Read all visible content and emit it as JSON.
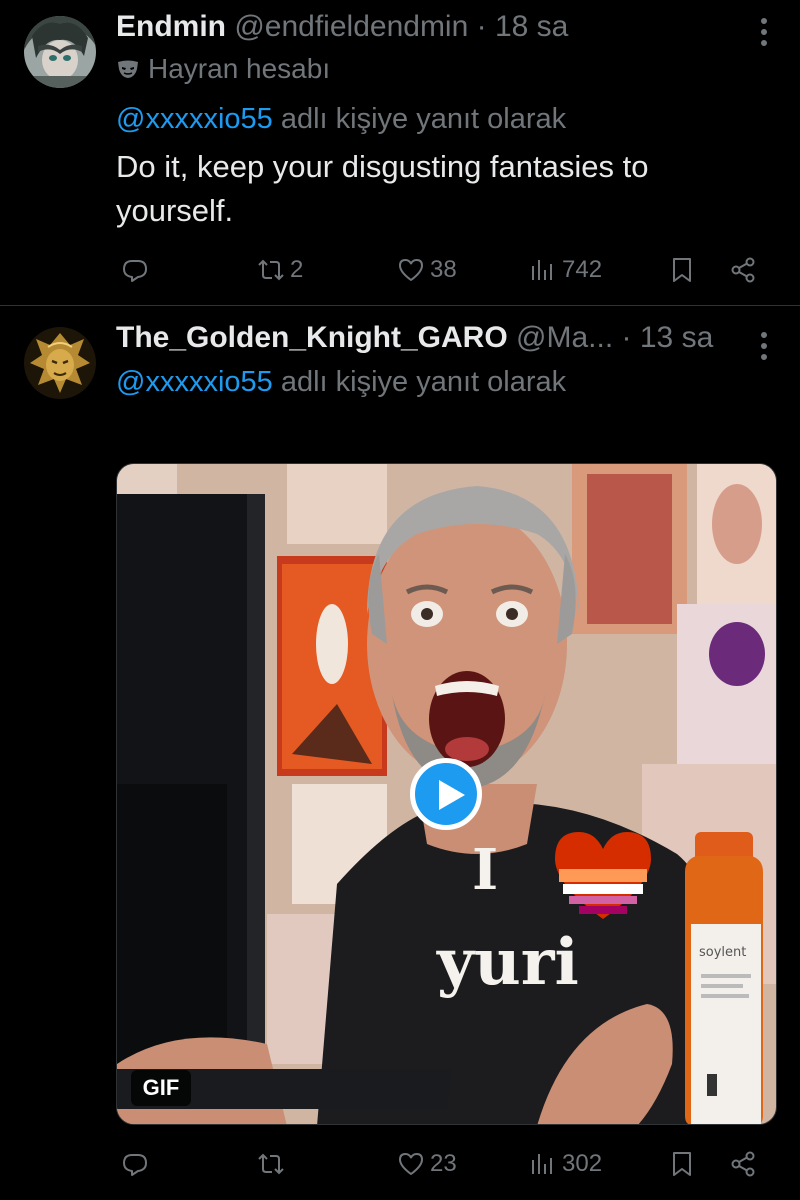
{
  "tweets": [
    {
      "display_name": "Endmin",
      "handle": "@endfieldendmin",
      "separator": "·",
      "time": "18 sa",
      "fan_label": "Hayran hesabı",
      "reply_mention": "@xxxxxio55",
      "reply_suffix": " adlı kişiye yanıt olarak",
      "text": "Do it, keep your disgusting fantasies to yourself.",
      "stats": {
        "replies": "",
        "retweets": "2",
        "likes": "38",
        "views": "742"
      }
    },
    {
      "display_name": "The_Golden_Knight_GARO",
      "handle": "@Ma...",
      "separator": "·",
      "time": "13 sa",
      "reply_mention": "@xxxxxio55",
      "reply_suffix": " adlı kişiye yanıt olarak",
      "media": {
        "type": "gif",
        "badge": "GIF",
        "shirt_text_1": "I",
        "shirt_text_2": "yuri",
        "bottle_label": "soylent"
      },
      "stats": {
        "replies": "",
        "retweets": "",
        "likes": "23",
        "views": "302"
      }
    }
  ],
  "icons": {
    "reply": "reply-icon",
    "retweet": "retweet-icon",
    "like": "heart-icon",
    "views": "views-icon",
    "bookmark": "bookmark-icon",
    "share": "share-icon",
    "more": "more-dots-icon",
    "fan": "mask-icon",
    "play": "play-icon"
  },
  "colors": {
    "background": "#000000",
    "text_primary": "#e7e9ea",
    "text_secondary": "#71767b",
    "accent": "#1d9bf0",
    "divider": "#2f3336"
  }
}
